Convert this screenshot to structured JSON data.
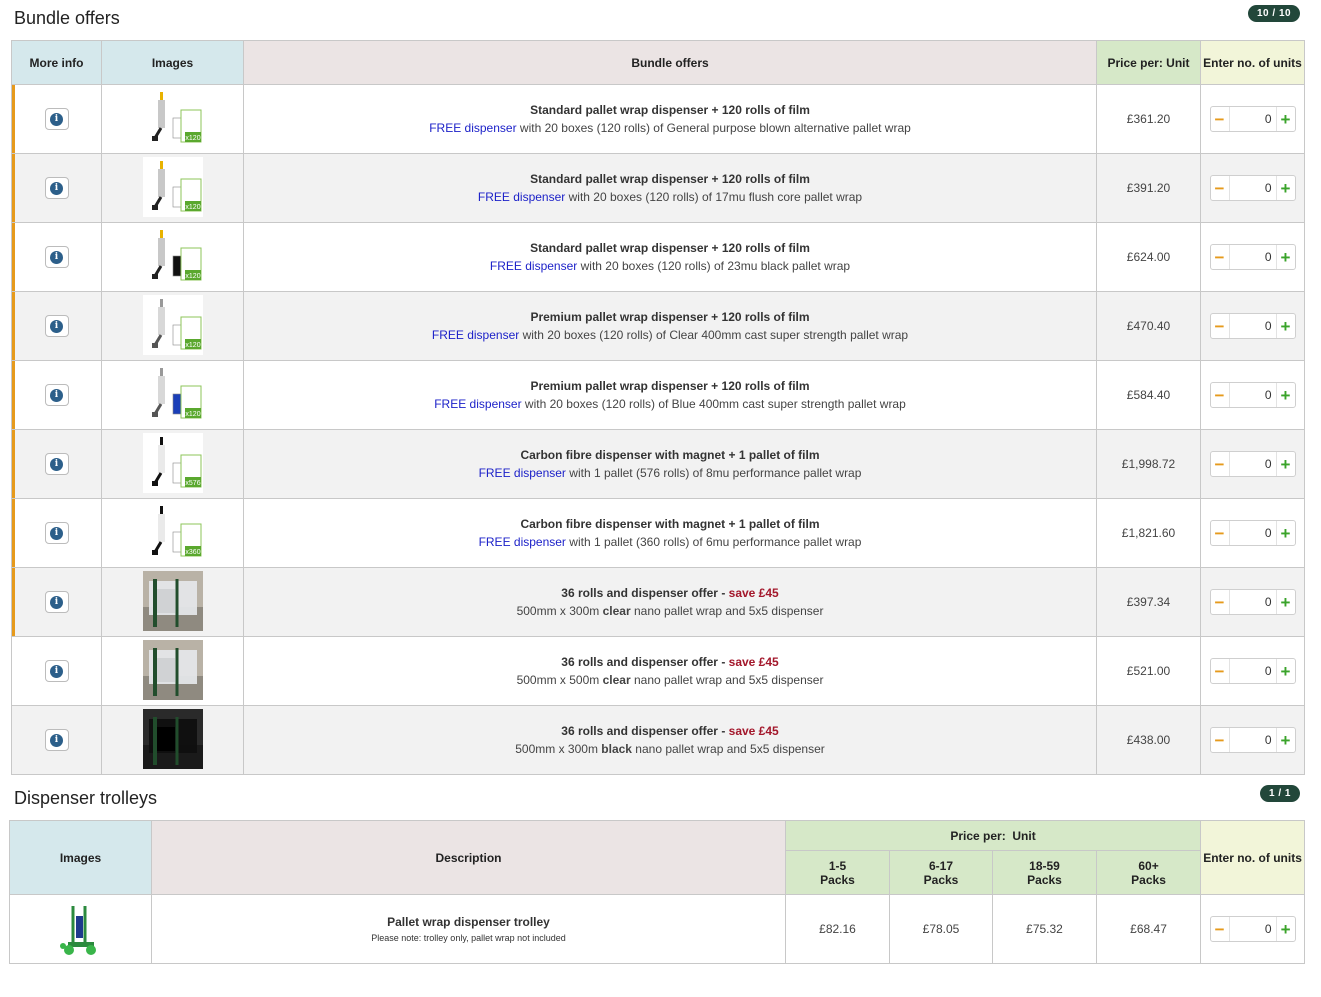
{
  "bundle": {
    "title": "Bundle offers",
    "badge": "10 / 10",
    "headers": {
      "more_info": "More info",
      "images": "Images",
      "bundle_offers": "Bundle offers",
      "price": "Price per: Unit",
      "enter_units": "Enter no. of units"
    },
    "rows": [
      {
        "title": "Standard pallet wrap dispenser + 120 rolls of film",
        "free": "FREE dispenser",
        "desc": " with 20 boxes (120 rolls) of General purpose blown alternative pallet wrap",
        "price": "£361.20",
        "qty": "0",
        "qty_tag": "x120",
        "image": "dispenser-standard-clear"
      },
      {
        "title": "Standard pallet wrap dispenser + 120 rolls of film",
        "free": "FREE dispenser",
        "desc": " with 20 boxes (120 rolls) of 17mu flush core pallet wrap",
        "price": "£391.20",
        "qty": "0",
        "qty_tag": "x120",
        "image": "dispenser-standard-clear"
      },
      {
        "title": "Standard pallet wrap dispenser + 120 rolls of film",
        "free": "FREE dispenser",
        "desc": " with 20 boxes (120 rolls) of 23mu black pallet wrap",
        "price": "£624.00",
        "qty": "0",
        "qty_tag": "x120",
        "image": "dispenser-standard-black"
      },
      {
        "title": "Premium pallet wrap dispenser + 120 rolls of film",
        "free": "FREE dispenser",
        "desc": " with 20 boxes (120 rolls) of Clear 400mm cast super strength pallet wrap",
        "price": "£470.40",
        "qty": "0",
        "qty_tag": "x120",
        "image": "dispenser-premium-clear"
      },
      {
        "title": "Premium pallet wrap dispenser + 120 rolls of film",
        "free": "FREE dispenser",
        "desc": " with 20 boxes (120 rolls) of Blue 400mm cast super strength pallet wrap",
        "price": "£584.40",
        "qty": "0",
        "qty_tag": "x120",
        "image": "dispenser-premium-blue"
      },
      {
        "title": "Carbon fibre dispenser with magnet + 1 pallet of film",
        "free": "FREE dispenser",
        "desc": " with 1 pallet (576 rolls) of 8mu performance pallet wrap",
        "price": "£1,998.72",
        "qty": "0",
        "qty_tag": "x576",
        "image": "dispenser-carbon"
      },
      {
        "title": "Carbon fibre dispenser with magnet + 1 pallet of film",
        "free": "FREE dispenser",
        "desc": " with 1 pallet (360 rolls) of 6mu performance pallet wrap",
        "price": "£1,821.60",
        "qty": "0",
        "qty_tag": "x360",
        "image": "dispenser-carbon"
      },
      {
        "title_prefix": "36 rolls and dispenser offer - ",
        "save": "save £45",
        "desc_pre": "500mm x 300m ",
        "desc_bold": "clear",
        "desc_post": " nano pallet wrap and 5x5 dispenser",
        "price": "£397.34",
        "qty": "0",
        "image": "pallet-photo-clear"
      },
      {
        "title_prefix": "36 rolls and dispenser offer - ",
        "save": "save £45",
        "desc_pre": "500mm x 500m ",
        "desc_bold": "clear",
        "desc_post": " nano pallet wrap and 5x5 dispenser",
        "price": "£521.00",
        "qty": "0",
        "image": "pallet-photo-clear"
      },
      {
        "title_prefix": "36 rolls and dispenser offer - ",
        "save": "save £45",
        "desc_pre": "500mm x 300m ",
        "desc_bold": "black",
        "desc_post": " nano pallet wrap and 5x5 dispenser",
        "price": "£438.00",
        "qty": "0",
        "image": "pallet-photo-black"
      }
    ]
  },
  "trolleys": {
    "title": "Dispenser trolleys",
    "badge": "1 / 1",
    "headers": {
      "images": "Images",
      "description": "Description",
      "price_group": "Price per:  Unit",
      "tiers": [
        {
          "range": "1-5",
          "unit": "Packs"
        },
        {
          "range": "6-17",
          "unit": "Packs"
        },
        {
          "range": "18-59",
          "unit": "Packs"
        },
        {
          "range": "60+",
          "unit": "Packs"
        }
      ],
      "enter_units": "Enter no. of units"
    },
    "rows": [
      {
        "title": "Pallet wrap dispenser trolley",
        "note": "Please note: trolley only, pallet wrap not included",
        "prices": [
          "£82.16",
          "£78.05",
          "£75.32",
          "£68.47"
        ],
        "qty": "0",
        "image": "trolley-green"
      }
    ]
  },
  "colors": {
    "accent_bar": "#e69a1c",
    "badge_bg": "#22473a",
    "free_link": "#1a1fc8",
    "save_text": "#a3172b",
    "minus": "#e69a1c",
    "plus": "#3aa32a",
    "info_icon": "#2c5f8a"
  }
}
